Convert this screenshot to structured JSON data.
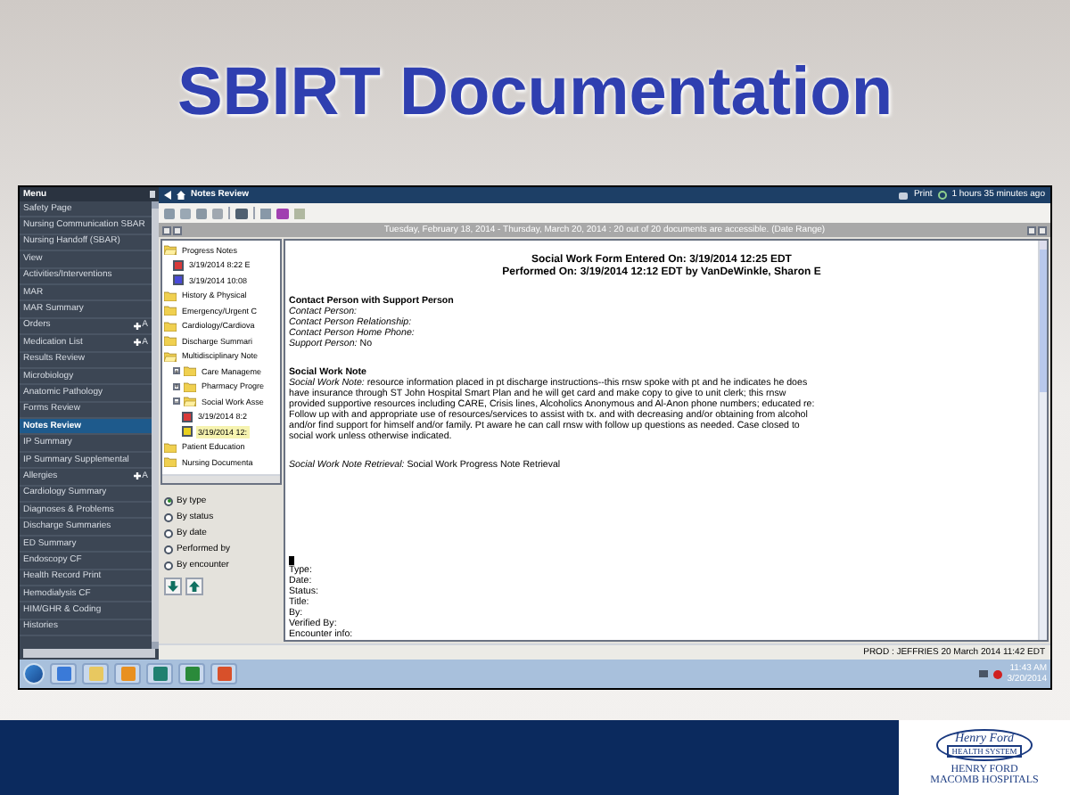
{
  "slide_title": "SBIRT Documentation",
  "menu": {
    "title": "Menu",
    "items": [
      {
        "label": "Safety Page",
        "selected": false
      },
      {
        "label": "Nursing Communication SBAR",
        "selected": false
      },
      {
        "label": "Nursing Handoff (SBAR)",
        "selected": false
      },
      {
        "label": "View",
        "selected": false
      },
      {
        "label": "Activities/Interventions",
        "selected": false
      },
      {
        "label": "MAR",
        "selected": false
      },
      {
        "label": "MAR Summary",
        "selected": false
      },
      {
        "label": "Orders",
        "selected": false,
        "action": "A"
      },
      {
        "label": "Medication List",
        "selected": false,
        "action": "A"
      },
      {
        "label": "Results Review",
        "selected": false
      },
      {
        "label": "Microbiology",
        "selected": false
      },
      {
        "label": "Anatomic Pathology",
        "selected": false
      },
      {
        "label": "Forms Review",
        "selected": false
      },
      {
        "label": "Notes Review",
        "selected": true
      },
      {
        "label": "IP Summary",
        "selected": false
      },
      {
        "label": "IP Summary Supplemental",
        "selected": false
      },
      {
        "label": "Allergies",
        "selected": false,
        "action": "A"
      },
      {
        "label": "Cardiology Summary",
        "selected": false
      },
      {
        "label": "Diagnoses & Problems",
        "selected": false
      },
      {
        "label": "Discharge Summaries",
        "selected": false
      },
      {
        "label": "ED Summary",
        "selected": false
      },
      {
        "label": "Endoscopy CF",
        "selected": false
      },
      {
        "label": "Health Record Print",
        "selected": false
      },
      {
        "label": "Hemodialysis CF",
        "selected": false
      },
      {
        "label": "HIM/GHR & Coding",
        "selected": false
      },
      {
        "label": "Histories",
        "selected": false
      }
    ]
  },
  "header": {
    "title": "Notes Review",
    "print": "Print",
    "refreshed": "1 hours 35 minutes ago"
  },
  "date_range": "Tuesday, February 18, 2014 - Thursday, March 20, 2014 : 20 out of 20 documents are accessible. (Date Range)",
  "tree": [
    {
      "kind": "folder",
      "label": "Progress Notes",
      "expanded": true,
      "children": [
        {
          "kind": "doc",
          "label": "3/19/2014 8:22 E",
          "color": "#d83a3a",
          "selected": false
        },
        {
          "kind": "doc",
          "label": "3/19/2014 10:08",
          "color": "#4a4ad8",
          "selected": false
        }
      ]
    },
    {
      "kind": "folder",
      "label": "History & Physical",
      "expanded": false
    },
    {
      "kind": "folder",
      "label": "Emergency/Urgent C",
      "expanded": false
    },
    {
      "kind": "folder",
      "label": "Cardiology/Cardiova",
      "expanded": false
    },
    {
      "kind": "folder",
      "label": "Discharge Summari",
      "expanded": false
    },
    {
      "kind": "folder",
      "label": "Multidisciplinary Note",
      "expanded": true,
      "children": [
        {
          "kind": "folder",
          "label": "Care Manageme",
          "expanded": false
        },
        {
          "kind": "folder",
          "label": "Pharmacy Progre",
          "expanded": false
        },
        {
          "kind": "folder",
          "label": "Social Work Asse",
          "expanded": true,
          "children": [
            {
              "kind": "doc",
              "label": "3/19/2014 8:2",
              "color": "#d83a3a",
              "selected": false
            },
            {
              "kind": "doc",
              "label": "3/19/2014 12:",
              "color": "#e8d020",
              "selected": true
            }
          ]
        }
      ]
    },
    {
      "kind": "folder",
      "label": "Patient Education",
      "expanded": false
    },
    {
      "kind": "folder",
      "label": "Nursing Documenta",
      "expanded": false
    }
  ],
  "sort_options": [
    {
      "label": "By type",
      "selected": true
    },
    {
      "label": "By status",
      "selected": false
    },
    {
      "label": "By date",
      "selected": false
    },
    {
      "label": "Performed by",
      "selected": false
    },
    {
      "label": "By encounter",
      "selected": false
    }
  ],
  "document": {
    "entered": "Social Work Form Entered On:  3/19/2014 12:25 EDT",
    "performed": "Performed On:  3/19/2014 12:12 EDT by VanDeWinkle, Sharon E",
    "sections": [
      {
        "heading": "Contact Person with Support Person",
        "lines": [
          "*Contact Person:*",
          "*Contact Person Relationship:*",
          "*Contact Person Home Phone:*",
          "*Support Person:*   No"
        ]
      },
      {
        "heading": "Social Work Note",
        "lines": [
          "*Social Work Note:*    resource information placed in pt discharge instructions--this rnsw spoke with pt and he indicates he does have insurance through ST John Hospital Smart Plan and he will get card and make copy to give to unit clerk;  this rnsw  provided supportive resources including CARE, Crisis lines, Alcoholics Anonymous and Al-Anon phone numbers; educated re: Follow up with and appropriate use of resources/services to assist with tx. and  with  decreasing and/or obtaining from alcohol and/or find support for himself and/or family.    Pt aware he can call rnsw with follow up questions as needed. Case closed to social work unless otherwise indicated."
        ]
      },
      {
        "lines": [
          "*Social Work Note Retrieval:*    Social Work Progress Note Retrieval"
        ]
      }
    ],
    "fields": [
      "Type:",
      "Date:",
      "Status:",
      "Title:",
      "By:",
      "Verified By:",
      "Encounter info:"
    ]
  },
  "status_bar": "PROD : JEFFRIES  20 March 2014  11:42 EDT",
  "taskbar": {
    "time": "11:43 AM",
    "date": "3/20/2014"
  },
  "logo": {
    "name_top": "Henry Ford",
    "name_bottom": "HEALTH SYSTEM",
    "hospital_line1": "HENRY FORD",
    "hospital_line2": "MACOMB HOSPITALS"
  }
}
